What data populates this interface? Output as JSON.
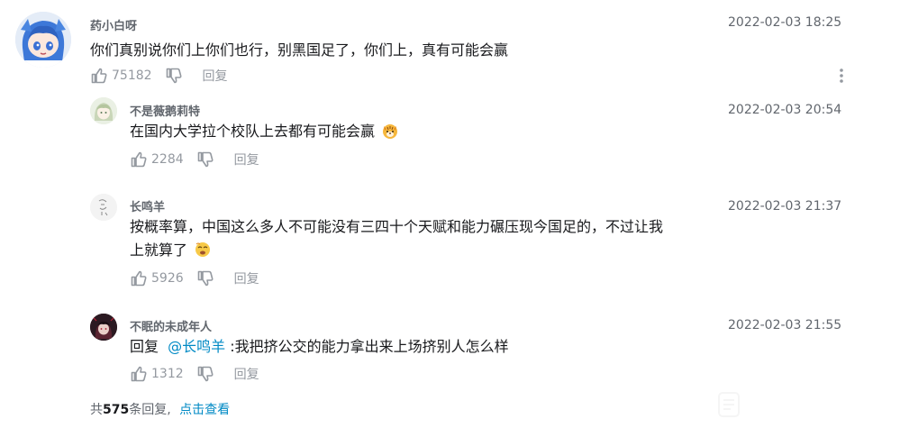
{
  "comments": [
    {
      "username": "药小白呀",
      "content": "你们真别说你们上你们也行，别黑国足了，你们上，真有可能会赢",
      "time": "2022-02-03 18:25",
      "likes": "75182",
      "reply_label": "回复",
      "avatar_icon": "anime-girl-avatar"
    },
    {
      "username": "不是薇鹅莉特",
      "content": "在国内大学拉个校队上去都有可能会赢",
      "emoji": "tiger-emoji",
      "time": "2022-02-03 20:54",
      "likes": "2284",
      "reply_label": "回复",
      "avatar_icon": "anime-character-avatar"
    },
    {
      "username": "长鸣羊",
      "content_line1": "按概率算，中国这么多人不可能没有三四十个天赋和能力碾压现今国足的，不过让我",
      "content_line2": "上就算了",
      "emoji": "dizzy-emoji",
      "time": "2022-02-03 21:37",
      "likes": "5926",
      "reply_label": "回复",
      "avatar_icon": "sketch-avatar"
    },
    {
      "username": "不眠的未成年人",
      "reply_prefix": "回复",
      "mention": "@长鸣羊",
      "content": " :我把挤公交的能力拿出来上场挤别人怎么样",
      "time": "2022-02-03 21:55",
      "likes": "1312",
      "reply_label": "回复",
      "avatar_icon": "dark-avatar"
    }
  ],
  "footer": {
    "prefix": "共",
    "count": "575",
    "suffix": "条回复,",
    "link": "点击查看"
  },
  "icons": {
    "like": "thumbs-up-icon",
    "dislike": "thumbs-down-icon",
    "more": "more-vertical-icon"
  },
  "colors": {
    "link": "#008ac5",
    "meta": "#9499a0",
    "text": "#18191c",
    "username": "#61666d"
  }
}
